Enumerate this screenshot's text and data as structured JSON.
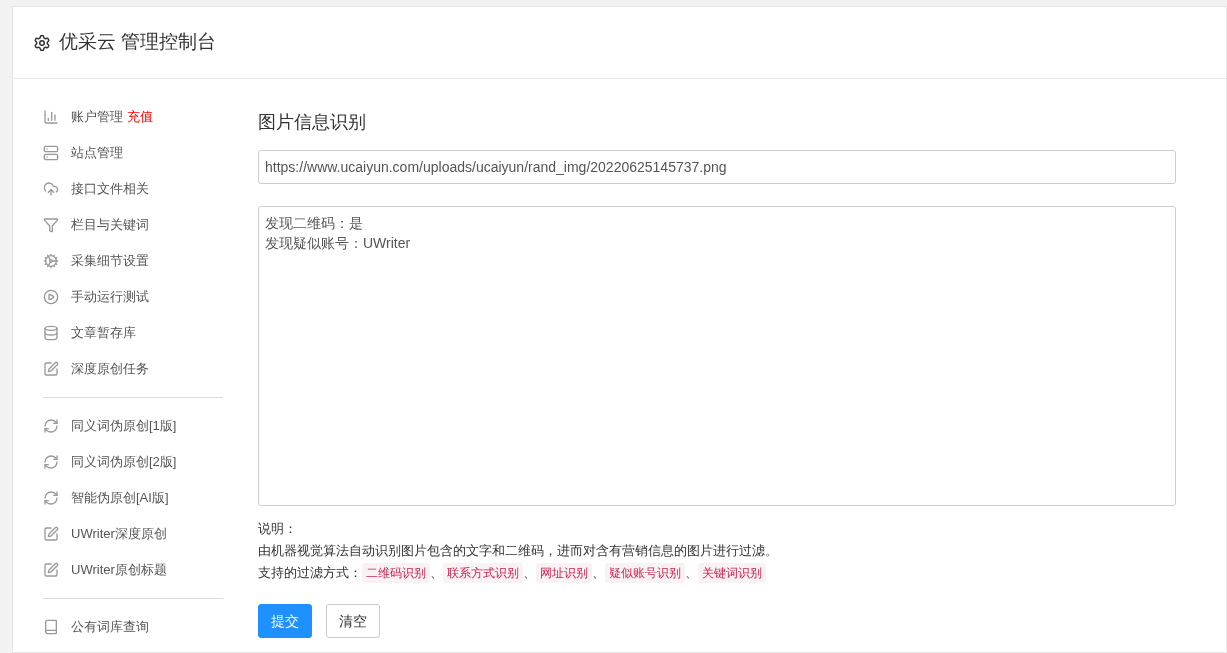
{
  "header": {
    "title": "优采云 管理控制台"
  },
  "sidebar": {
    "groups": [
      {
        "items": [
          {
            "label": "账户管理",
            "kind": "chart",
            "badge": "充值"
          },
          {
            "label": "站点管理",
            "kind": "server"
          },
          {
            "label": "接口文件相关",
            "kind": "cloud"
          },
          {
            "label": "栏目与关键词",
            "kind": "filter"
          },
          {
            "label": "采集细节设置",
            "kind": "cogs"
          },
          {
            "label": "手动运行测试",
            "kind": "play"
          },
          {
            "label": "文章暂存库",
            "kind": "database"
          },
          {
            "label": "深度原创任务",
            "kind": "edit"
          }
        ]
      },
      {
        "items": [
          {
            "label": "同义词伪原创[1版]",
            "kind": "refresh"
          },
          {
            "label": "同义词伪原创[2版]",
            "kind": "refresh"
          },
          {
            "label": "智能伪原创[AI版]",
            "kind": "refresh"
          },
          {
            "label": "UWriter深度原创",
            "kind": "edit"
          },
          {
            "label": "UWriter原创标题",
            "kind": "edit"
          }
        ]
      },
      {
        "items": [
          {
            "label": "公有词库查询",
            "kind": "book"
          }
        ]
      }
    ]
  },
  "main": {
    "title": "图片信息识别",
    "url_field": {
      "value": "https://www.ucaiyun.com/uploads/ucaiyun/rand_img/20220625145737.png"
    },
    "result_box": {
      "lines": [
        "发现二维码：是",
        "发现疑似账号：UWriter"
      ]
    },
    "notes": {
      "heading": "说明：",
      "description": "由机器视觉算法自动识别图片包含的文字和二维码，进而对含有营销信息的图片进行过滤。",
      "methods_label": "支持的过滤方式：",
      "separator": "、",
      "methods": [
        "二维码识别",
        "联系方式识别",
        "网址识别",
        "疑似账号识别",
        "关键词识别"
      ]
    },
    "buttons": [
      {
        "label": "提交",
        "kind": "primary"
      },
      {
        "label": "清空",
        "kind": "default"
      }
    ]
  }
}
